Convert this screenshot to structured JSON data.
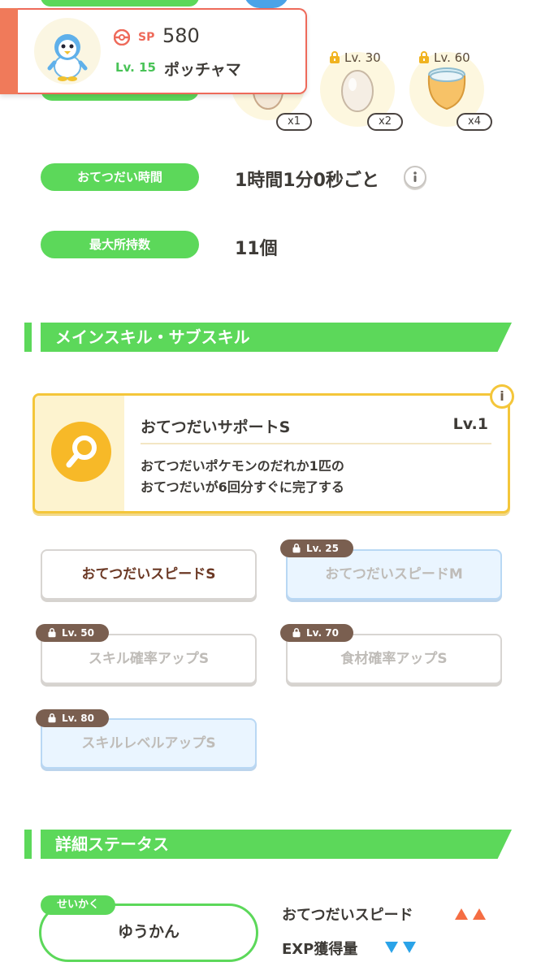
{
  "pokemon": {
    "sp_label": "SP",
    "sp_value": "580",
    "level_label": "Lv. 15",
    "name": "ポッチャマ"
  },
  "ingredients": {
    "slots": [
      {
        "lock": "",
        "count": "x1"
      },
      {
        "lock": "Lv. 30",
        "count": "x2"
      },
      {
        "lock": "Lv. 60",
        "count": "x4"
      }
    ]
  },
  "stats": {
    "help_time_label": "おてつだい時間",
    "help_time_value": "1時間1分0秒ごと",
    "max_carry_label": "最大所持数",
    "max_carry_value": "11個"
  },
  "sections": {
    "skills_title": "メインスキル・サブスキル",
    "details_title": "詳細ステータス"
  },
  "main_skill": {
    "name": "おてつだいサポートS",
    "level": "Lv.1",
    "desc_line1": "おてつだいポケモンのだれか1匹の",
    "desc_line2": "おてつだいが6回分すぐに完了する",
    "info": "i"
  },
  "sub_skills": [
    {
      "label": "おてつだいスピードS",
      "lock": ""
    },
    {
      "label": "おてつだいスピードM",
      "lock": "Lv. 25"
    },
    {
      "label": "スキル確率アップS",
      "lock": "Lv. 50"
    },
    {
      "label": "食材確率アップS",
      "lock": "Lv. 70"
    },
    {
      "label": "スキルレベルアップS",
      "lock": "Lv. 80"
    }
  ],
  "details": {
    "nature_tag": "せいかく",
    "nature_name": "ゆうかん",
    "effect_up_label": "おてつだいスピード",
    "effect_down_label": "EXP獲得量"
  },
  "colors": {
    "green": "#5cd85a",
    "accent_red": "#ee6a5a",
    "gold": "#f4c63a",
    "up_arrow": "#f56d43",
    "down_arrow": "#2aa3e8"
  },
  "icons": {
    "info": "info-icon",
    "lock": "lock-icon",
    "skill": "magnifier-icon"
  }
}
